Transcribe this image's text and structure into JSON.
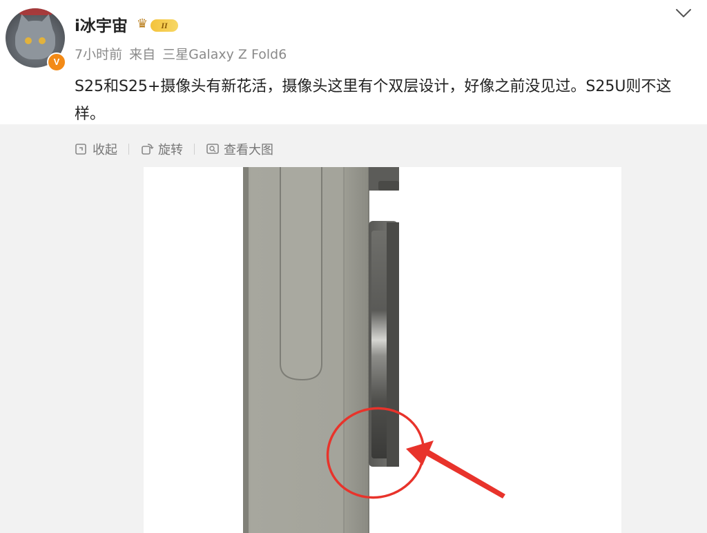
{
  "post": {
    "username": "i冰宇宙",
    "level": "II",
    "time": "7小时前",
    "source_prefix": "来自",
    "source_device": "三星Galaxy Z Fold6",
    "text": "S25和S25+摄像头有新花活，摄像头这里有个双层设计，好像之前没见过。S25U则不这样。",
    "verified_badge": "V"
  },
  "toolbar": {
    "collapse_label": "收起",
    "rotate_label": "旋转",
    "view_large_label": "查看大图"
  },
  "icons": {
    "collapse": "collapse-icon",
    "rotate": "rotate-icon",
    "view_large": "view-large-icon",
    "more": "chevron-down-icon",
    "level": "crown-icon"
  },
  "colors": {
    "accent": "#f38a16",
    "level_gold": "#f4c33c",
    "annotation_red": "#e8332b",
    "meta_gray": "#8a8a8a"
  }
}
